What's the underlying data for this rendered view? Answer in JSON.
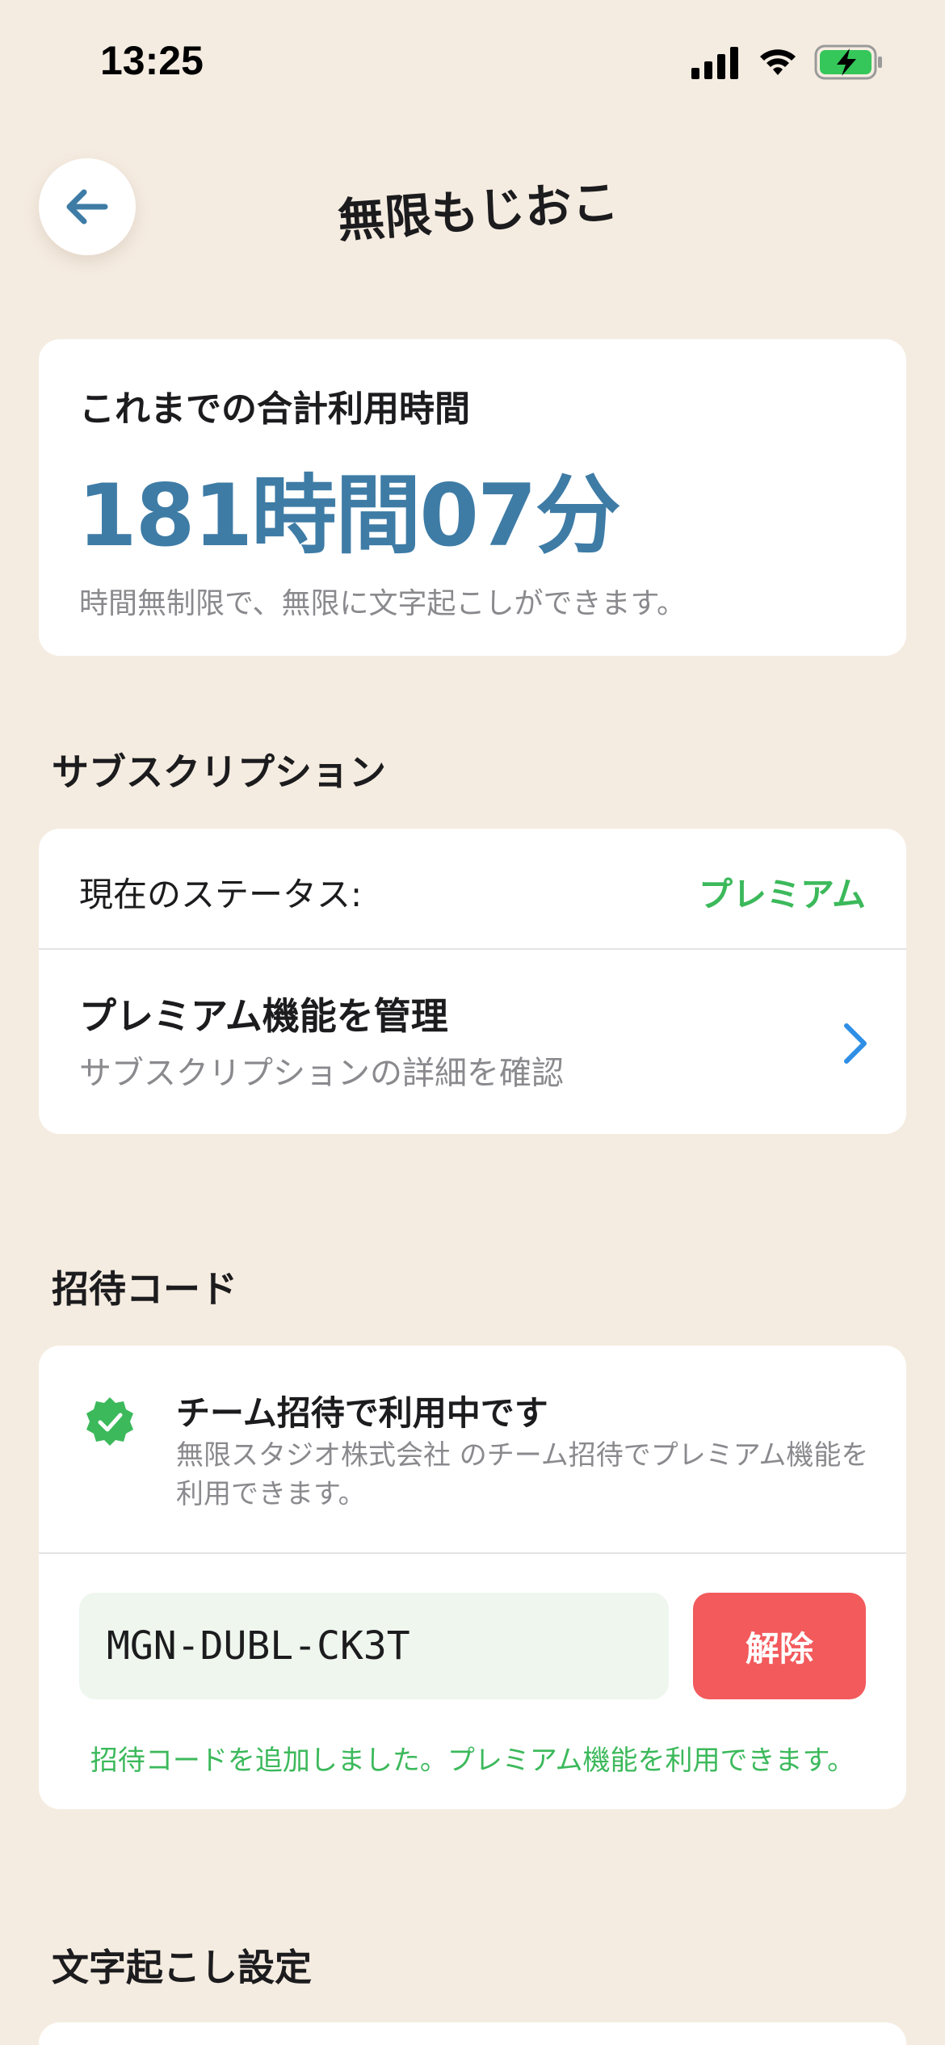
{
  "status_bar": {
    "time": "13:25"
  },
  "header": {
    "logo_text": "無限もじおこし"
  },
  "usage": {
    "label": "これまでの合計利用時間",
    "value": "181時間07分",
    "description": "時間無制限で、無限に文字起こしができます。",
    "value_color": "#3E7CA6"
  },
  "subscription": {
    "section_title": "サブスクリプション",
    "status_label": "現在のステータス:",
    "status_value": "プレミアム",
    "manage_title": "プレミアム機能を管理",
    "manage_subtitle": "サブスクリプションの詳細を確認"
  },
  "invite": {
    "section_title": "招待コード",
    "title": "チーム招待で利用中です",
    "description": "無限スタジオ株式会社 のチーム招待でプレミアム機能を利用できます。",
    "code_value": "MGN-DUBL-CK3T",
    "release_label": "解除",
    "success_message": "招待コードを追加しました。プレミアム機能を利用できます。",
    "success_color": "#3CB95B",
    "danger_color": "#F25A5C"
  },
  "transcription_settings": {
    "section_title": "文字起こし設定"
  }
}
